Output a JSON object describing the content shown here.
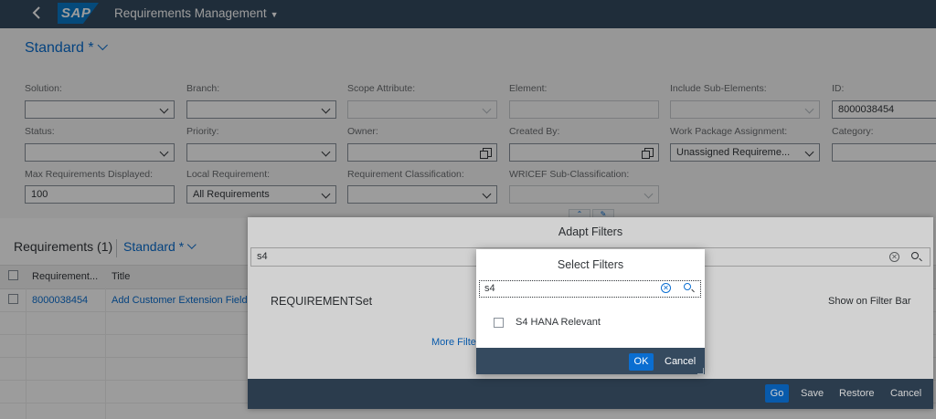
{
  "shell": {
    "back_icon": "chevron-left-icon",
    "logo_text": "SAP",
    "app_title": "Requirements Management"
  },
  "filterbar": {
    "variant": "Standard *",
    "fields": {
      "solution": {
        "label": "Solution:",
        "value": ""
      },
      "branch": {
        "label": "Branch:",
        "value": ""
      },
      "scope_attribute": {
        "label": "Scope Attribute:",
        "value": ""
      },
      "element": {
        "label": "Element:",
        "value": ""
      },
      "include_sub_elements": {
        "label": "Include Sub-Elements:",
        "value": ""
      },
      "id": {
        "label": "ID:",
        "value": "8000038454"
      },
      "status": {
        "label": "Status:",
        "value": ""
      },
      "priority": {
        "label": "Priority:",
        "value": ""
      },
      "owner": {
        "label": "Owner:",
        "value": ""
      },
      "created_by": {
        "label": "Created By:",
        "value": ""
      },
      "work_package_assignment": {
        "label": "Work Package Assignment:",
        "value": "Unassigned Requireme..."
      },
      "category": {
        "label": "Category:",
        "value": ""
      },
      "max_requirements": {
        "label": "Max Requirements Displayed:",
        "value": "100"
      },
      "local_requirement": {
        "label": "Local Requirement:",
        "value": "All Requirements"
      },
      "requirement_classification": {
        "label": "Requirement Classification:",
        "value": ""
      },
      "wricef_sub_classification": {
        "label": "WRICEF Sub-Classification:",
        "value": ""
      }
    }
  },
  "table": {
    "title": "Requirements (1)",
    "variant": "Standard *",
    "columns": [
      "Requirement...",
      "Title"
    ],
    "rows": [
      {
        "id": "8000038454",
        "title": "Add Customer Extension Field"
      }
    ]
  },
  "adapt_filters": {
    "title": "Adapt Filters",
    "search_value": "s4",
    "group_title": "REQUIREMENTSet",
    "show_on_filter_bar": "Show on Filter Bar",
    "more_filters": "More Filte",
    "footer": {
      "go": "Go",
      "save": "Save",
      "restore": "Restore",
      "cancel": "Cancel"
    }
  },
  "select_filters": {
    "title": "Select Filters",
    "search_value": "s4",
    "items": [
      {
        "label": "S4 HANA Relevant",
        "checked": false
      }
    ],
    "ok": "OK",
    "cancel": "Cancel"
  },
  "colors": {
    "shell": "#354a5f",
    "accent": "#0a6ed1",
    "logo": "#0a7ac9"
  }
}
